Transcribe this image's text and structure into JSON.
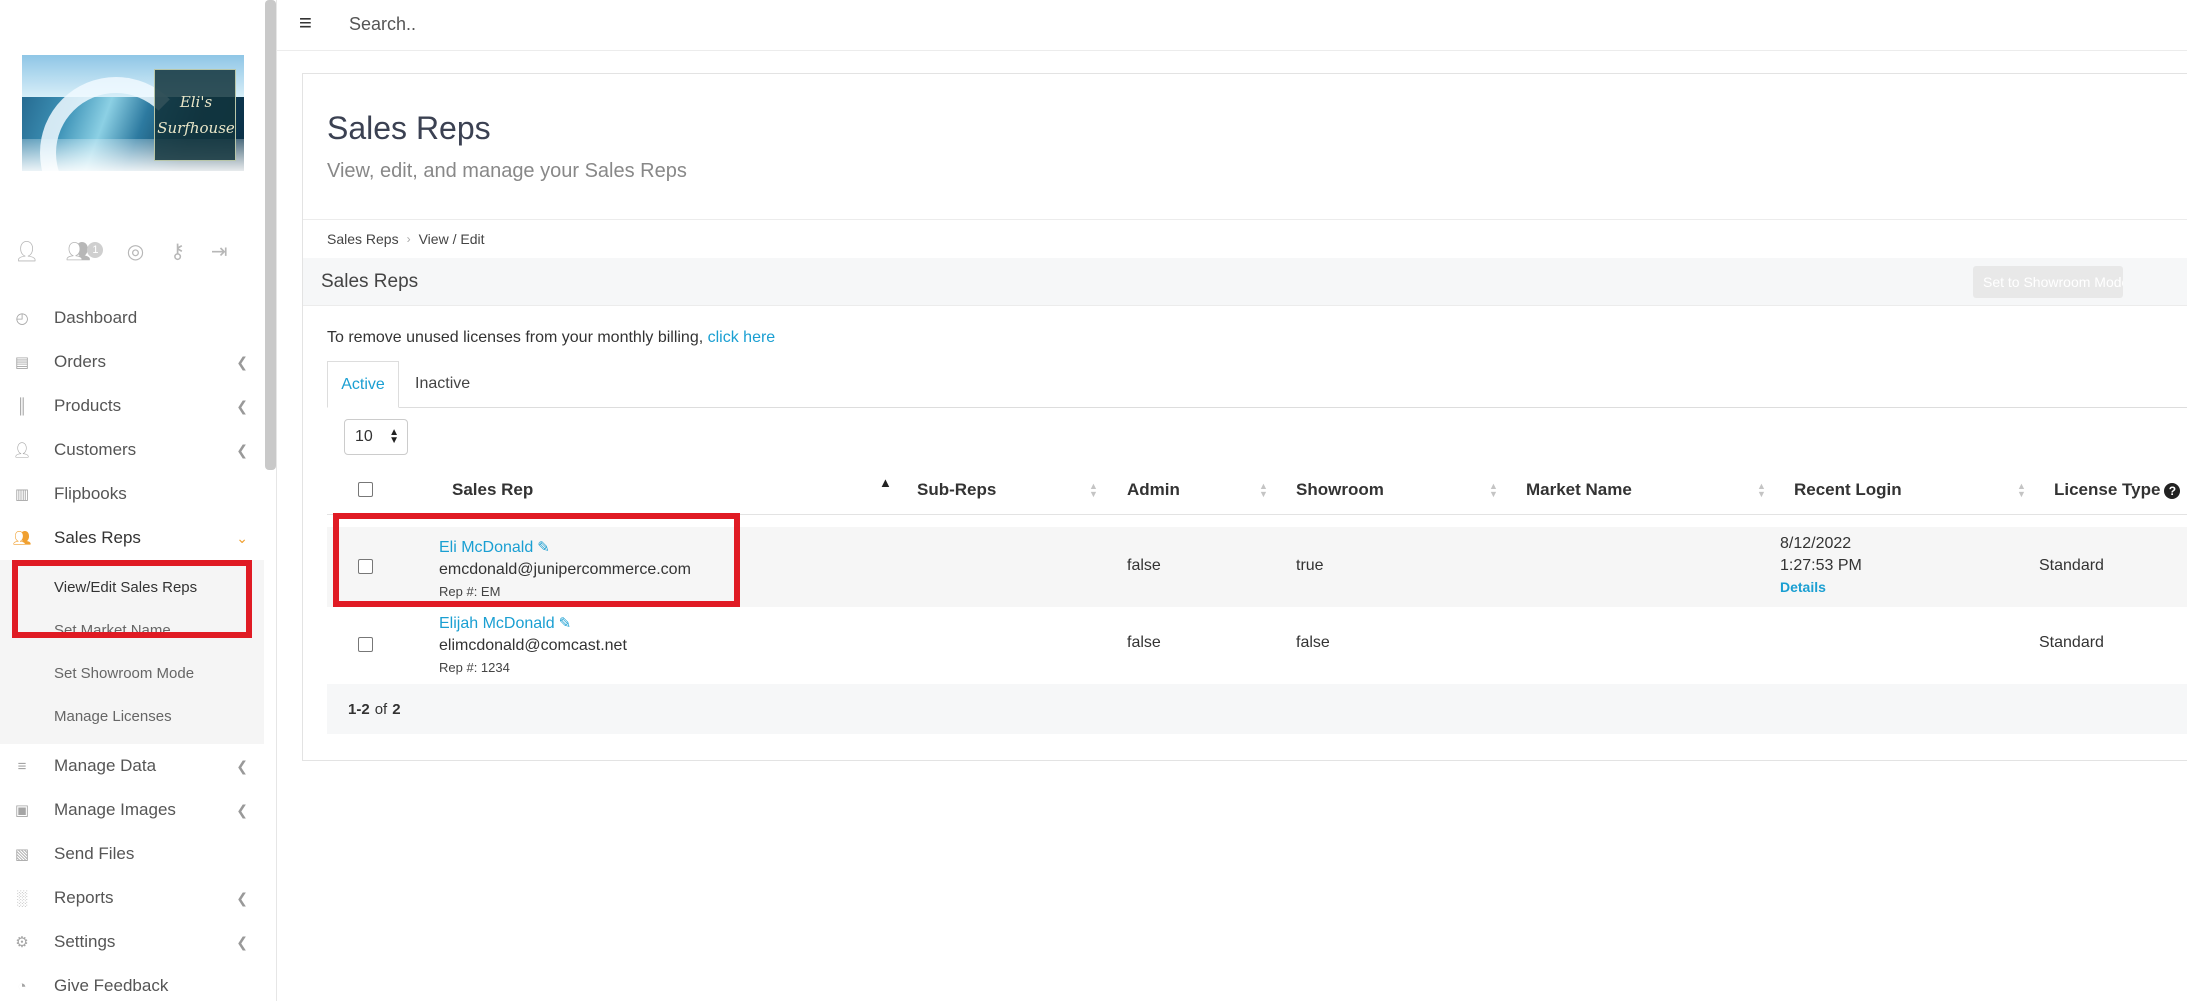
{
  "logo": {
    "text_line1": "Eli's",
    "text_line2": "Surfhouse"
  },
  "user_icons": {
    "badge_count": "1"
  },
  "sidebar": {
    "items": [
      {
        "label": "Dashboard",
        "icon": "dashboard-icon",
        "chevron": false
      },
      {
        "label": "Orders",
        "icon": "orders-icon",
        "chevron": true
      },
      {
        "label": "Products",
        "icon": "products-icon",
        "chevron": true
      },
      {
        "label": "Customers",
        "icon": "customers-icon",
        "chevron": true
      },
      {
        "label": "Flipbooks",
        "icon": "flipbooks-icon",
        "chevron": false
      },
      {
        "label": "Sales Reps",
        "icon": "sales-reps-icon",
        "chevron": true,
        "active": true
      }
    ],
    "sales_reps_sub": [
      "View/Edit Sales Reps",
      "Set Market Name",
      "Set Showroom Mode",
      "Manage Licenses"
    ],
    "items_after": [
      {
        "label": "Manage Data",
        "icon": "manage-data-icon",
        "chevron": true
      },
      {
        "label": "Manage Images",
        "icon": "manage-images-icon",
        "chevron": true
      },
      {
        "label": "Send Files",
        "icon": "send-files-icon",
        "chevron": false
      },
      {
        "label": "Reports",
        "icon": "reports-icon",
        "chevron": true
      },
      {
        "label": "Settings",
        "icon": "settings-icon",
        "chevron": true
      },
      {
        "label": "Give Feedback",
        "icon": "feedback-icon",
        "chevron": false
      }
    ]
  },
  "topbar": {
    "search_placeholder": "Search.."
  },
  "page": {
    "title": "Sales Reps",
    "subtitle": "View, edit, and manage your Sales Reps"
  },
  "breadcrumb": [
    "Sales Reps",
    "View / Edit"
  ],
  "section": {
    "title": "Sales Reps",
    "showroom_button": "Set to Showroom Mode"
  },
  "license_note": {
    "text": "To remove unused licenses from your monthly billing,",
    "link": "click here"
  },
  "tabs": [
    "Active",
    "Inactive"
  ],
  "per_page": "10",
  "table": {
    "columns": [
      "Sales Rep",
      "Sub-Reps",
      "Admin",
      "Showroom",
      "Market Name",
      "Recent Login",
      "License Type"
    ],
    "rows": [
      {
        "name": "Eli McDonald",
        "email": "emcdonald@junipercommerce.com",
        "rep": "Rep #: EM",
        "sub_reps": "",
        "admin": "false",
        "showroom": "true",
        "market_name": "",
        "login_date": "8/12/2022",
        "login_time": "1:27:53 PM",
        "login_link": "Details",
        "license": "Standard"
      },
      {
        "name": "Elijah McDonald",
        "email": "elimcdonald@comcast.net",
        "rep": "Rep #: 1234",
        "sub_reps": "",
        "admin": "false",
        "showroom": "false",
        "market_name": "",
        "login_date": "",
        "login_time": "",
        "login_link": "",
        "license": "Standard"
      }
    ]
  },
  "pager": {
    "range": "1-2",
    "of": "of",
    "total": "2"
  },
  "colors": {
    "accent": "#1a9fd2",
    "active_nav": "#f0a030",
    "highlight": "#e01b24"
  }
}
